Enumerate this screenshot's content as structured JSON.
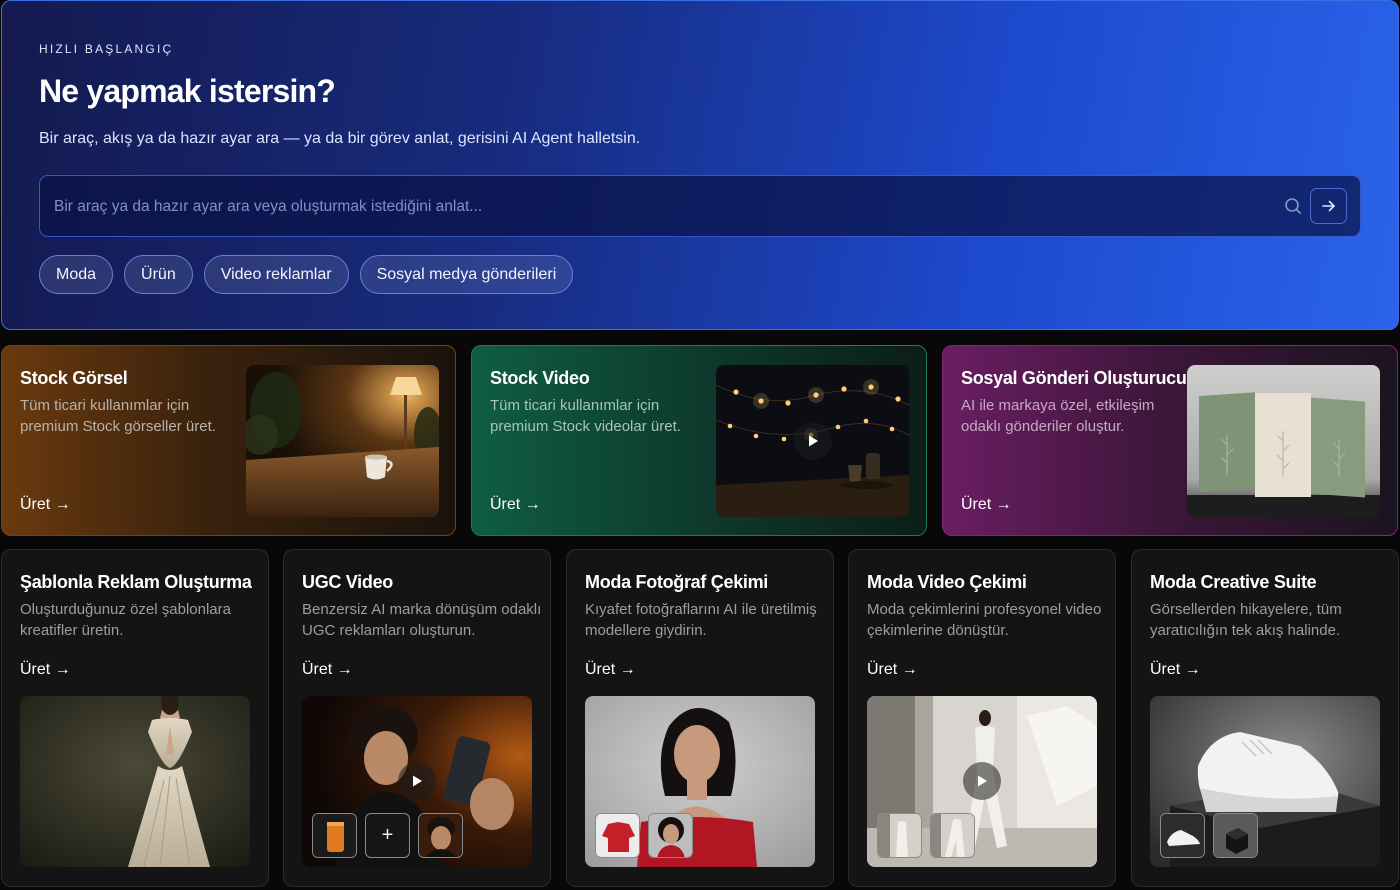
{
  "hero": {
    "kicker": "HIZLI BAŞLANGIÇ",
    "title": "Ne yapmak istersin?",
    "subtitle": "Bir araç, akış ya da hazır ayar ara — ya da bir görev anlat, gerisini AI Agent halletsin.",
    "search_placeholder": "Bir araç ya da hazır ayar ara veya oluşturmak istediğini anlat...",
    "chips": [
      "Moda",
      "Ürün",
      "Video reklamlar",
      "Sosyal medya gönderileri"
    ]
  },
  "featured": [
    {
      "title": "Stock Görsel",
      "description": "Tüm ticari kullanımlar için premium Stock görseller üret.",
      "cta": "Üret →",
      "accent": "#6a3a0e"
    },
    {
      "title": "Stock Video",
      "description": "Tüm ticari kullanımlar için premium Stock videolar üret.",
      "cta": "Üret →",
      "accent": "#0f5d44"
    },
    {
      "title": "Sosyal Gönderi Oluşturucu",
      "description": "AI ile markaya özel, etkileşim odaklı gönderiler oluştur.",
      "cta": "Üret →",
      "accent": "#6a1e63"
    }
  ],
  "tools": [
    {
      "title": "Şablonla Reklam Oluşturma",
      "description": "Oluşturduğunuz özel şablonlara kreatifler üretin.",
      "cta": "Üret →"
    },
    {
      "title": "UGC Video",
      "description": "Benzersiz AI marka dönüşüm odaklı UGC reklamları oluşturun.",
      "cta": "Üret →"
    },
    {
      "title": "Moda Fotoğraf Çekimi",
      "description": "Kıyafet fotoğraflarını AI ile üretilmiş modellere giydirin.",
      "cta": "Üret →"
    },
    {
      "title": "Moda Video Çekimi",
      "description": "Moda çekimlerini profesyonel video çekimlerine dönüştür.",
      "cta": "Üret →"
    },
    {
      "title": "Moda Creative Suite",
      "description": "Görsellerden hikayelere, tüm yaratıcılığın tek akış halinde.",
      "cta": "Üret →"
    }
  ],
  "ugc_plus": "+",
  "icons": {
    "search": "search-icon",
    "go": "arrow-right-icon",
    "play": "play-icon"
  }
}
